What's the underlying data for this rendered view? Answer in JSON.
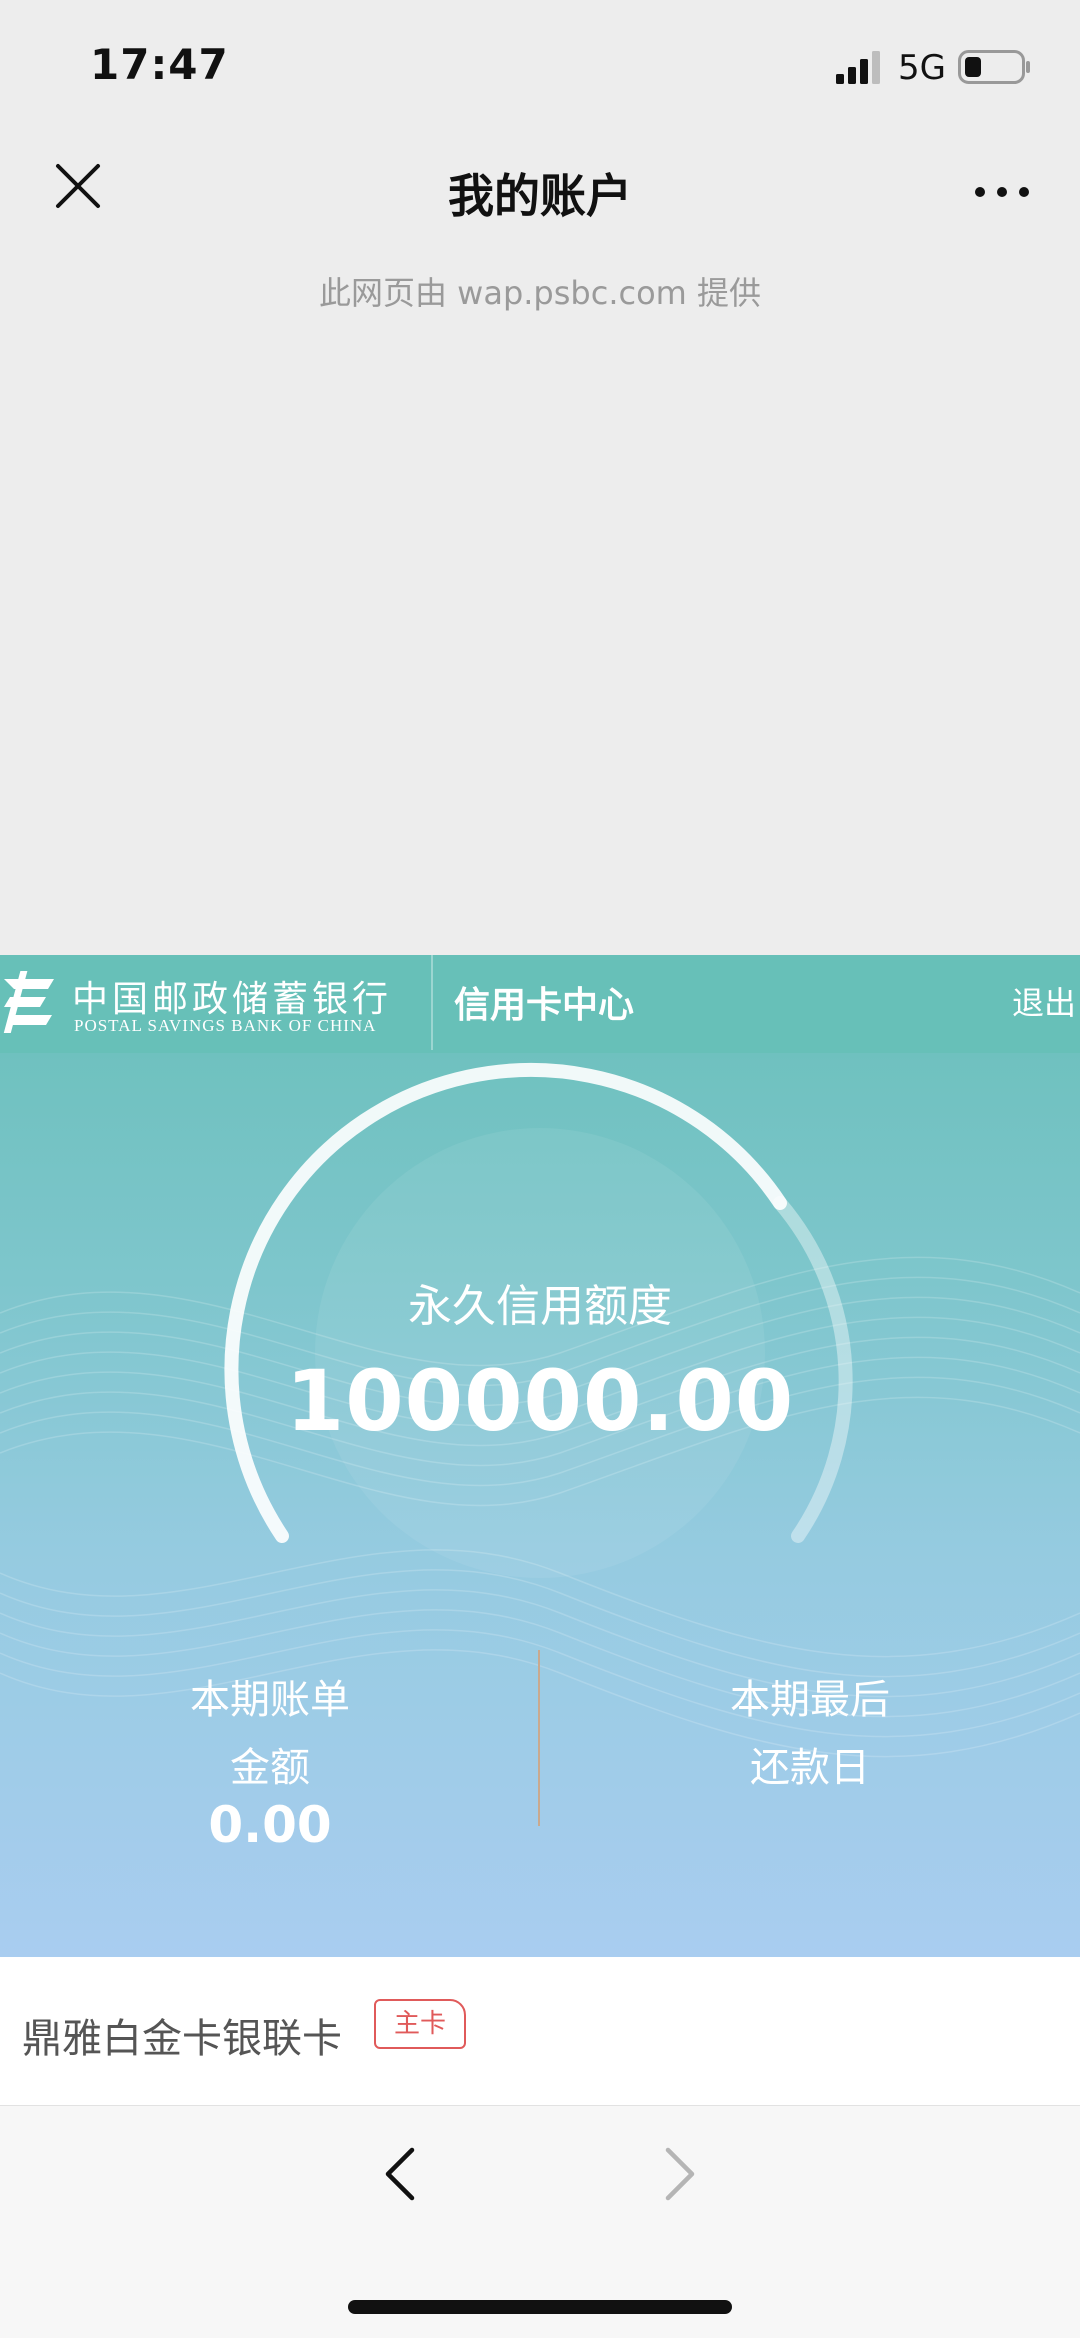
{
  "status_bar": {
    "time": "17:47",
    "network": "5G",
    "icons": [
      "signal-icon",
      "battery-icon"
    ]
  },
  "nav": {
    "title": "我的账户",
    "provider_note": "此网页由 wap.psbc.com 提供",
    "icons": [
      "close-icon",
      "more-icon"
    ]
  },
  "bank_header": {
    "name_cn": "中国邮政储蓄银行",
    "name_en": "POSTAL SAVINGS BANK OF CHINA",
    "center_title": "信用卡中心",
    "logout": "退出",
    "color": "#67c0b8"
  },
  "credit": {
    "label": "永久信用额度",
    "value": "100000.00"
  },
  "bill": {
    "label_line1": "本期账单",
    "label_line2": "金额",
    "value": "0.00"
  },
  "due": {
    "label_line1": "本期最后",
    "label_line2": "还款日"
  },
  "card": {
    "name": "鼎雅白金卡银联卡",
    "badge": "主卡",
    "badge_color": "#e05a5a"
  },
  "bottom_nav": {
    "icons": [
      "back-arrow-icon",
      "forward-arrow-icon"
    ]
  }
}
